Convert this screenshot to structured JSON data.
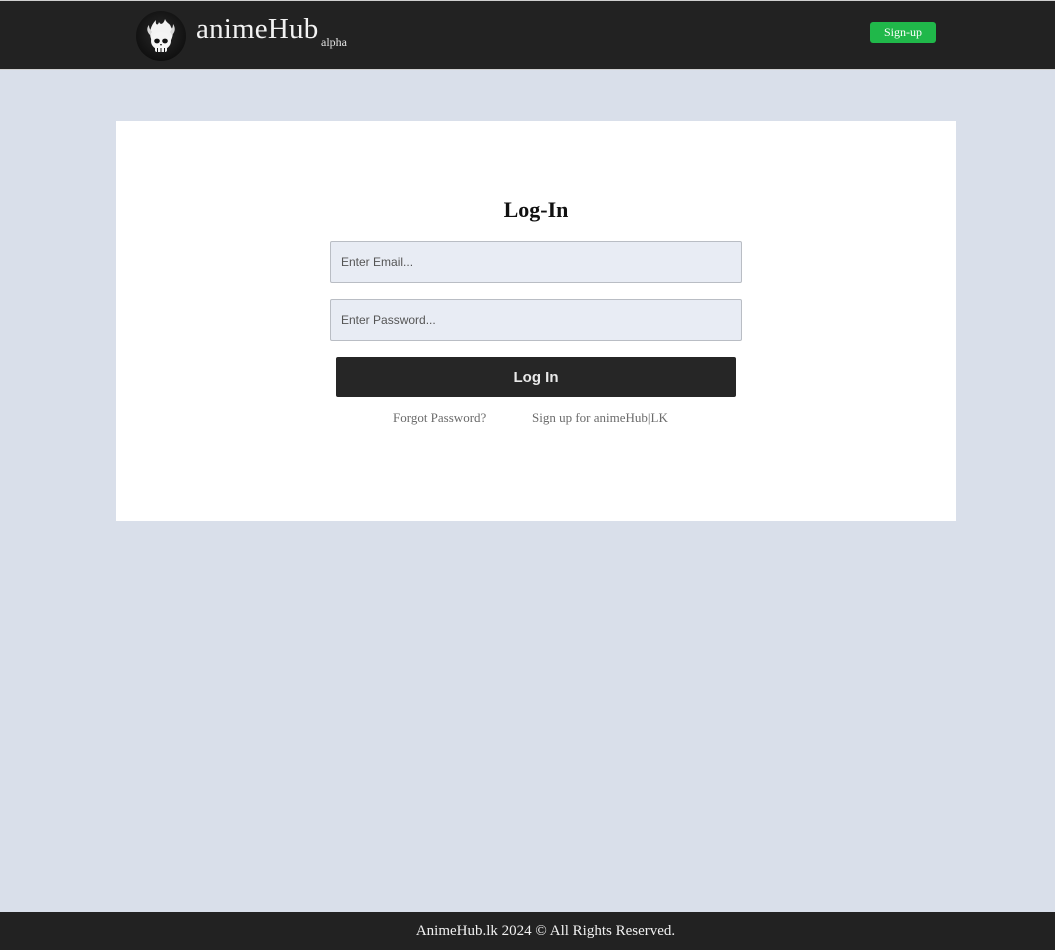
{
  "header": {
    "brand": "animeHub",
    "brand_tag": "alpha",
    "logo_icon": "flaming-skull-icon",
    "signup_label": "Sign-up",
    "signup_color": "#20b84a",
    "bar_color": "#222222"
  },
  "login": {
    "title": "Log-In",
    "email_placeholder": "Enter Email...",
    "email_value": "",
    "password_placeholder": "Enter Password...",
    "password_value": "",
    "submit_label": "Log In",
    "forgot_label": "Forgot Password?",
    "signup_label": "Sign up for animeHub|LK"
  },
  "footer": {
    "text": "AnimeHub.lk 2024 © All Rights Reserved."
  },
  "colors": {
    "page_background": "#d9dfea",
    "card_background": "#ffffff",
    "button_background": "#262626"
  }
}
